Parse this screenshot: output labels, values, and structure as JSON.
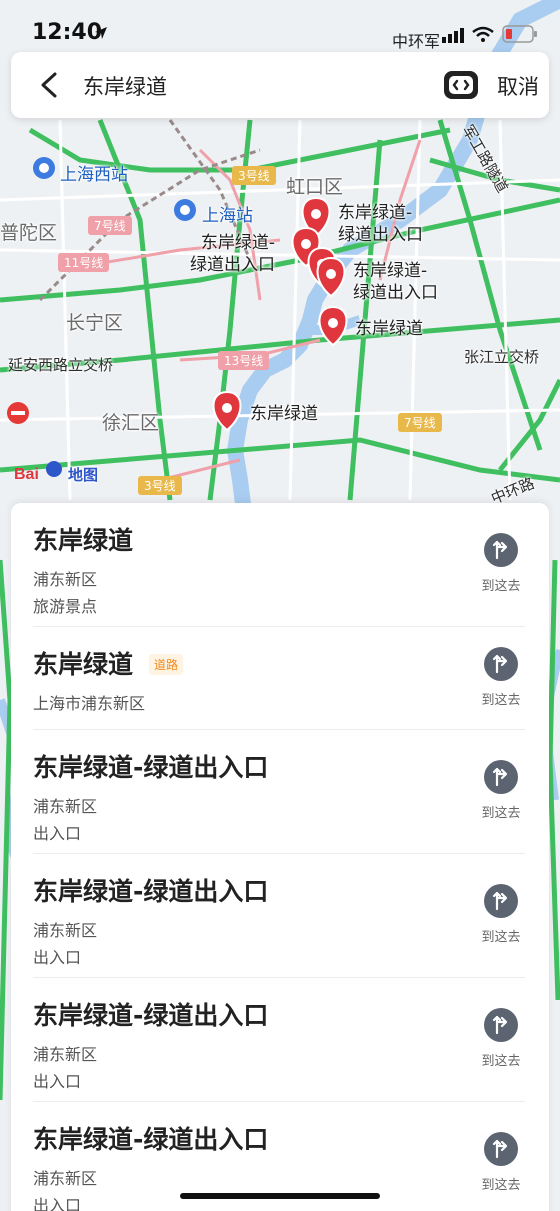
{
  "status_bar": {
    "time": "12:40",
    "road_hint": "中环军"
  },
  "search": {
    "query": "东岸绿道",
    "cancel_label": "取消"
  },
  "map": {
    "area_labels": {
      "putuo": "普陀区",
      "hongkou": "虹口区",
      "changning": "长宁区",
      "xuhui": "徐汇区"
    },
    "stations": {
      "shanghai_west": "上海西站",
      "shanghai": "上海站"
    },
    "roads": {
      "yanan_west": "延安西路立交桥",
      "zhangjiang": "张江立交桥",
      "zhonghuan": "中环路",
      "tunnel": "军工路隧道"
    },
    "metro_lines": {
      "line3a": "3号线",
      "line7a": "7号线",
      "line11": "11号线",
      "line13": "13号线",
      "line7b": "7号线",
      "line3b": "3号线"
    },
    "logo_text": "地图",
    "pin_labels": {
      "pin1": "东岸绿道-\n绿道出入口",
      "pin2": "东岸绿道-\n绿道出入口",
      "pin3": "东岸绿道-\n绿道出入口",
      "pin4": "东岸绿道",
      "pin5": "东岸绿道"
    }
  },
  "results": {
    "go_label": "到这去",
    "items": [
      {
        "title": "东岸绿道",
        "tag": "",
        "line1": "浦东新区",
        "line2": "旅游景点"
      },
      {
        "title": "东岸绿道",
        "tag": "道路",
        "line1": "上海市浦东新区",
        "line2": ""
      },
      {
        "title": "东岸绿道-绿道出入口",
        "tag": "",
        "line1": "浦东新区",
        "line2": "出入口"
      },
      {
        "title": "东岸绿道-绿道出入口",
        "tag": "",
        "line1": "浦东新区",
        "line2": "出入口"
      },
      {
        "title": "东岸绿道-绿道出入口",
        "tag": "",
        "line1": "浦东新区",
        "line2": "出入口"
      },
      {
        "title": "东岸绿道-绿道出入口",
        "tag": "",
        "line1": "浦东新区",
        "line2": "出入口"
      }
    ]
  },
  "colors": {
    "pin": "#e0373f",
    "river": "#a9cdf0",
    "highway": "#3fbf5f",
    "metro_badge": "#f0a0a8"
  }
}
